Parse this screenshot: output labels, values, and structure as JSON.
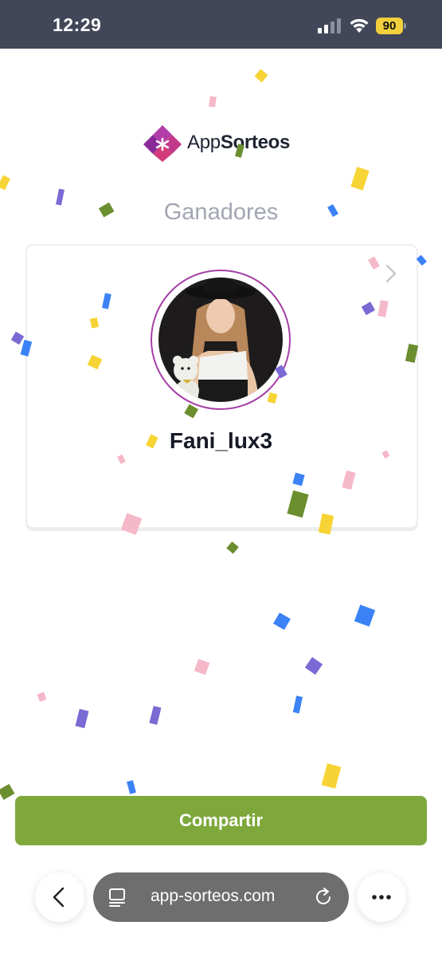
{
  "status_bar": {
    "time": "12:29",
    "battery": "90",
    "icons": [
      "signal-icon",
      "wifi-icon",
      "battery-icon"
    ]
  },
  "logo": {
    "text_regular": "App",
    "text_bold": "Sorteos",
    "icon": "appsorteos-logo-icon"
  },
  "page": {
    "title": "Ganadores"
  },
  "winner": {
    "name": "Fani_lux3",
    "avatar_icon": "winner-avatar",
    "chevron_icon": "chevron-right-icon"
  },
  "actions": {
    "share_label": "Compartir"
  },
  "browser": {
    "url": "app-sorteos.com",
    "icons": [
      "back-icon",
      "tabs-icon",
      "reload-icon",
      "more-icon"
    ]
  },
  "colors": {
    "status_bar": "#414758",
    "share_button": "#7ea83c",
    "avatar_ring": "#a43fa4",
    "title_gray": "#a2a6b2",
    "confetti": [
      "#f7d435",
      "#f5b8c8",
      "#7a6ad4",
      "#3b82f6",
      "#6b8e2f"
    ]
  }
}
